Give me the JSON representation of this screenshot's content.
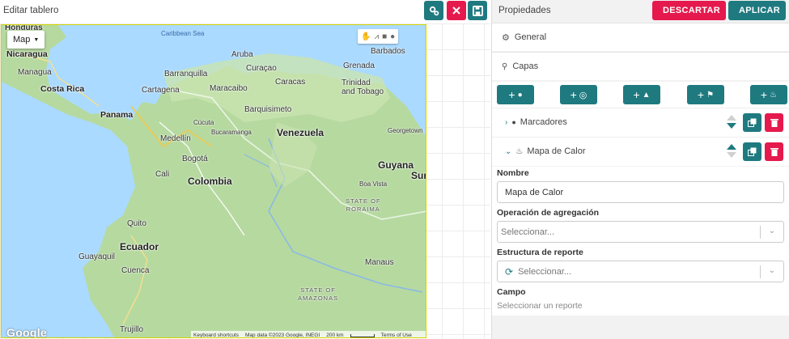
{
  "editor": {
    "title": "Editar tablero",
    "settings_icon": "settings-gears-icon",
    "close_icon": "close-x-icon",
    "save_icon": "floppy-save-icon"
  },
  "map": {
    "type_label": "Map",
    "labels": {
      "caribbean": "Caribbean Sea",
      "honduras": "Honduras",
      "nicaragua": "Nicaragua",
      "managua": "Managua",
      "costa_rica": "Costa Rica",
      "panama": "Panama",
      "aruba": "Aruba",
      "curacao": "Curaçao",
      "barbados": "Barbados",
      "grenada": "Grenada",
      "barranquilla": "Barranquilla",
      "caracas": "Caracas",
      "trinidad": "Trinidad\nand Tobago",
      "cartagena": "Cartagena",
      "maracaibo": "Maracaibo",
      "cucuta": "Cúcuta",
      "barquisimeto": "Barquisimeto",
      "venezuela": "Venezuela",
      "georgetown": "Georgetown",
      "medellin": "Medellín",
      "bucaramanga": "Bucaramanga",
      "bogota": "Bogotá",
      "guyana": "Guyana",
      "suriname": "Suri",
      "cali": "Cali",
      "colombia": "Colombia",
      "boa_vista": "Boa Vista",
      "roraima": "STATE OF\nRORAIMA",
      "quito": "Quito",
      "ecuador": "Ecuador",
      "guayaquil": "Guayaquil",
      "cuenca": "Cuenca",
      "manaus": "Manaus",
      "amazonas": "STATE OF\nAMAZONAS",
      "trujillo": "Trujillo"
    },
    "google_logo": "Google",
    "attribution": {
      "shortcuts": "Keyboard shortcuts",
      "data": "Map data ©2023 Google, INEGI",
      "scale": "200 km",
      "terms": "Terms of Use"
    }
  },
  "props": {
    "title": "Propiedades",
    "discard_label": "DESCARTAR",
    "apply_label": "APLICAR",
    "general_label": "General",
    "layers_label": "Capas",
    "add_buttons": [
      "marker-icon",
      "circle-icon",
      "route-icon",
      "area-icon",
      "heat-icon"
    ],
    "layers": [
      {
        "label": "Marcadores",
        "icon": "map-pin-icon",
        "expanded": false
      },
      {
        "label": "Mapa de Calor",
        "icon": "fire-icon",
        "expanded": true
      }
    ],
    "form": {
      "name_label": "Nombre",
      "name_value": "Mapa de Calor",
      "aggregation_label": "Operación de agregación",
      "aggregation_placeholder": "Seleccionar...",
      "report_label": "Estructura de reporte",
      "report_placeholder": "Seleccionar...",
      "field_label": "Campo",
      "field_hint": "Seleccionar un reporte"
    }
  }
}
